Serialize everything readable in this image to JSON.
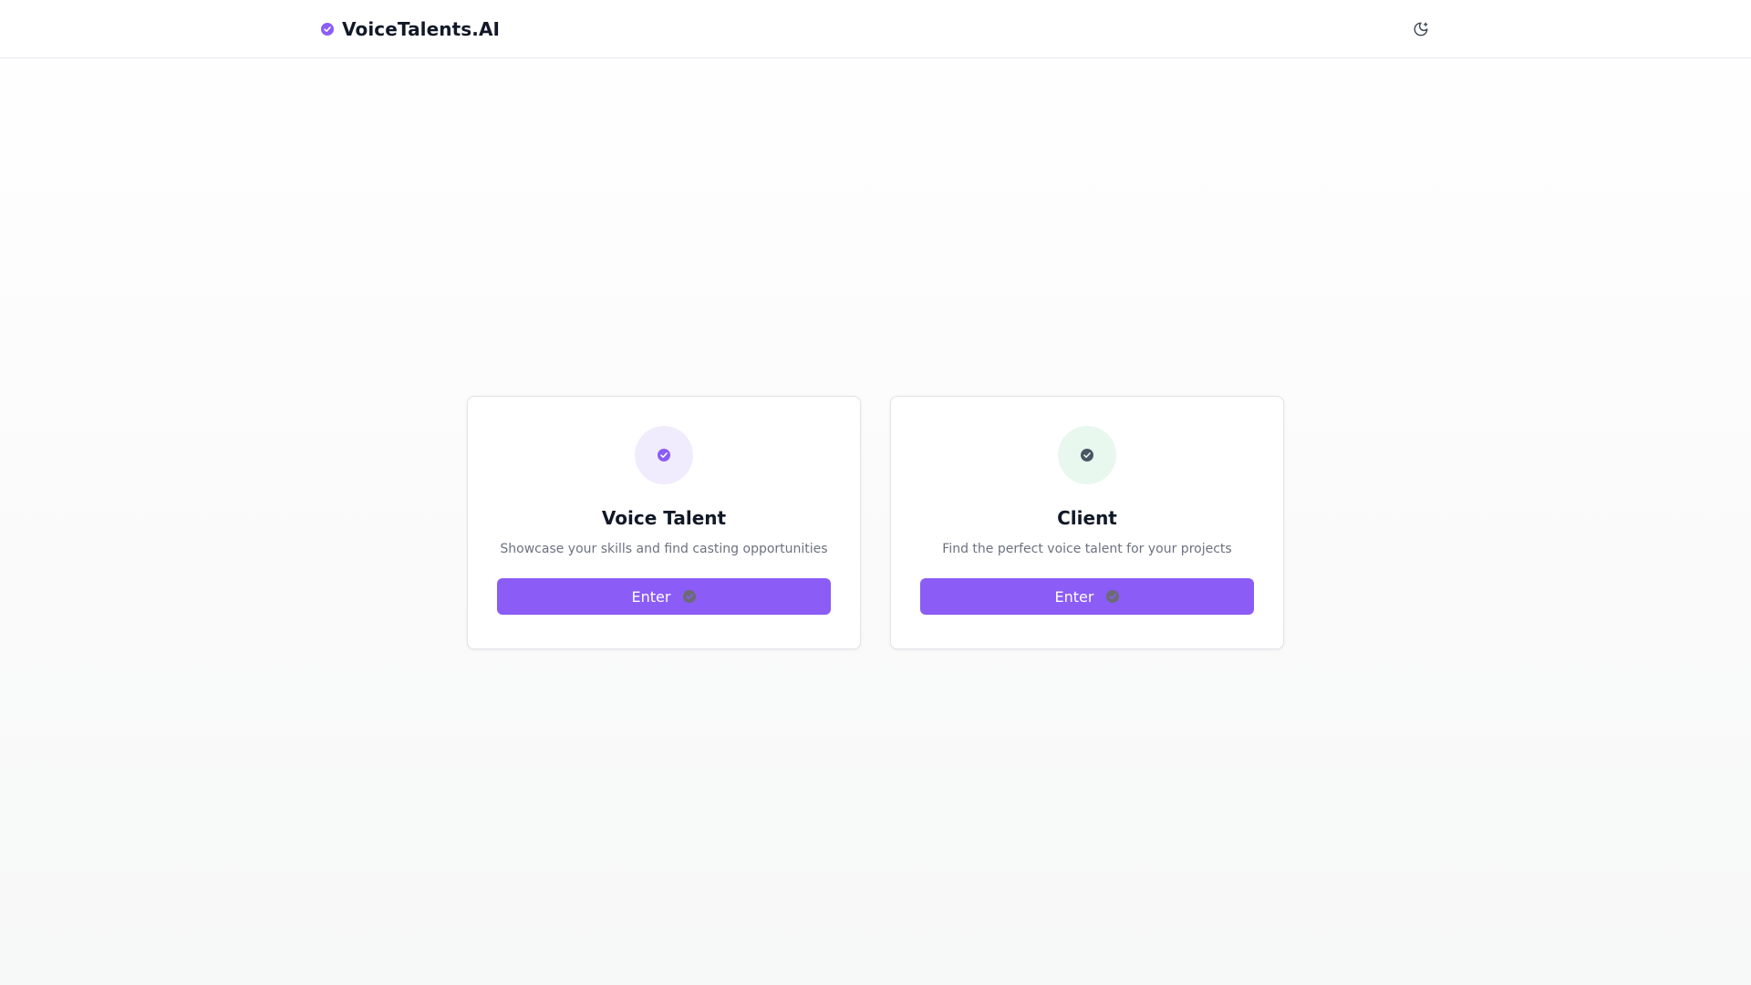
{
  "header": {
    "brand_name": "VoiceTalents.AI",
    "brand_icon": "check-circle-icon",
    "theme_toggle_icon": "moon-icon"
  },
  "roles": [
    {
      "title": "Voice Talent",
      "description": "Showcase your skills and find casting opportunities",
      "button_label": "Enter",
      "icon": "check-circle-icon"
    },
    {
      "title": "Client",
      "description": "Find the perfect voice talent for your projects",
      "button_label": "Enter",
      "icon": "check-circle-icon"
    }
  ],
  "colors": {
    "accent": "#8b5cf6",
    "talent_badge_bg": "#f1ecfd",
    "client_badge_bg": "#e9f8ee",
    "text_primary": "#111827",
    "text_muted": "#6b7280"
  }
}
